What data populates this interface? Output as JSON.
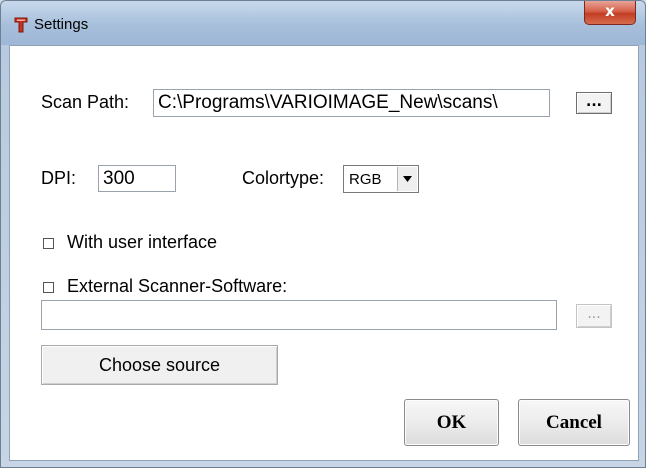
{
  "window": {
    "title": "Settings",
    "close_glyph": "x"
  },
  "scan_path": {
    "label": "Scan Path:",
    "value": "C:\\Programs\\VARIOIMAGE_New\\scans\\",
    "browse_label": "..."
  },
  "dpi": {
    "label": "DPI:",
    "value": "300"
  },
  "colortype": {
    "label": "Colortype:",
    "selected": "RGB"
  },
  "options": {
    "with_ui_label": "With user interface",
    "with_ui_checked": false,
    "external_label": "External Scanner-Software:",
    "external_checked": false,
    "external_value": "",
    "external_browse_label": "..."
  },
  "buttons": {
    "choose_source": "Choose source",
    "ok": "OK",
    "cancel": "Cancel"
  },
  "icons": {
    "app": "scanner-app-icon",
    "combo_arrow": "chevron-down-icon"
  },
  "colors": {
    "titlebar": "#a9c1dc",
    "close_button": "#c23d24",
    "app_icon": "#c8311f"
  }
}
